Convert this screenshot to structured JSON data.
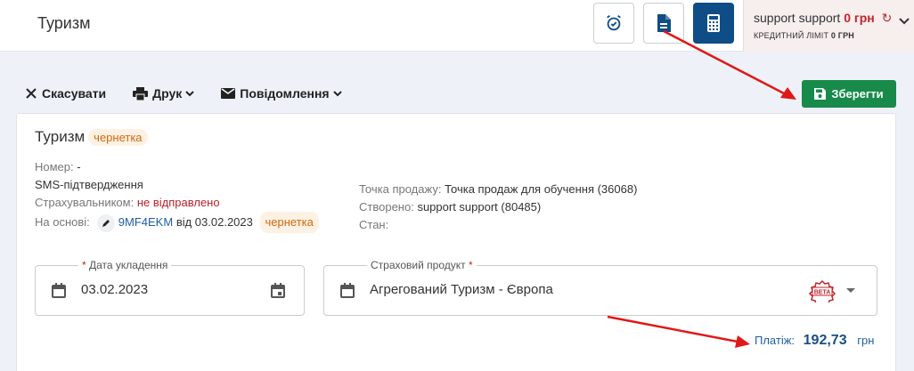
{
  "header": {
    "title": "Туризм",
    "user_name": "support support",
    "balance": "0 грн",
    "credit_label": "КРЕДИТНИЙ ЛІМІТ",
    "credit_value": "0 ГРН"
  },
  "toolbar": {
    "cancel": "Скасувати",
    "print": "Друк",
    "message": "Повідомлення",
    "save": "Зберегти"
  },
  "document": {
    "title": "Туризм",
    "status": "чернетка",
    "number_label": "Номер:",
    "number_value": "-",
    "sms_label": "SMS-підтвердження",
    "insurer_label": "Страхувальником:",
    "insurer_value": "не відправлено",
    "based_label": "На основі:",
    "based_link": "9MF4EKM",
    "based_date": "від 03.02.2023",
    "based_status": "чернетка",
    "point_label": "Точка продажу:",
    "point_value": "Точка продаж для обучення (36068)",
    "created_label": "Створено:",
    "created_value": "support support (80485)",
    "state_label": "Стан:"
  },
  "form": {
    "date_label": "Дата укладення",
    "date_value": "03.02.2023",
    "product_label": "Страховий продукт",
    "product_value": "Агрегований Туризм - Європа",
    "beta_text": "BETA",
    "required_mark": "*"
  },
  "payment": {
    "label": "Платіж:",
    "amount": "192,73",
    "currency": "грн"
  },
  "colors": {
    "brand": "#0f4d86",
    "save": "#188a4a",
    "error": "#c0262b",
    "draft": "#d2690e",
    "annotation": "#e01818"
  }
}
